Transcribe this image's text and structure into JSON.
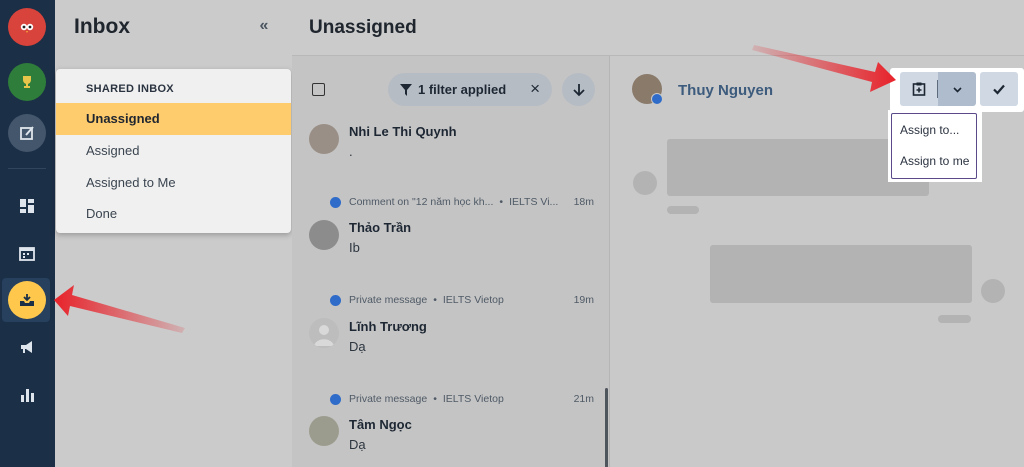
{
  "sidebar": {
    "title": "Inbox",
    "collapse_icon": "«",
    "menu": {
      "heading": "SHARED INBOX",
      "items": [
        {
          "label": "Unassigned",
          "active": true
        },
        {
          "label": "Assigned",
          "active": false
        },
        {
          "label": "Assigned to Me",
          "active": false
        },
        {
          "label": "Done",
          "active": false
        }
      ]
    }
  },
  "header": {
    "title": "Unassigned"
  },
  "list": {
    "filter_label": "1 filter applied",
    "clear_icon": "×",
    "conversations": [
      {
        "name": "Nhi Le Thi Quynh",
        "message": ".",
        "meta_type": "",
        "meta_source": "",
        "time": ""
      },
      {
        "name": "Thảo Trần",
        "message": "Ib",
        "meta_type": "Comment on \"12 năm học kh...",
        "meta_source": "IELTS Vi...",
        "time": "18m"
      },
      {
        "name": "Lĩnh Trương",
        "message": "Dạ",
        "meta_type": "Private message",
        "meta_source": "IELTS Vietop",
        "time": "19m"
      },
      {
        "name": "Tâm Ngọc",
        "message": "Dạ",
        "meta_type": "Private message",
        "meta_source": "IELTS Vietop",
        "time": "21m"
      }
    ]
  },
  "conversation": {
    "contact_name": "Thuy Nguyen",
    "assign_menu": [
      "Assign to...",
      "Assign to me"
    ]
  },
  "colors": {
    "rail": "#1b2f47",
    "active_item": "#ffcc6d",
    "annotation_arrow": "#e8222a"
  }
}
